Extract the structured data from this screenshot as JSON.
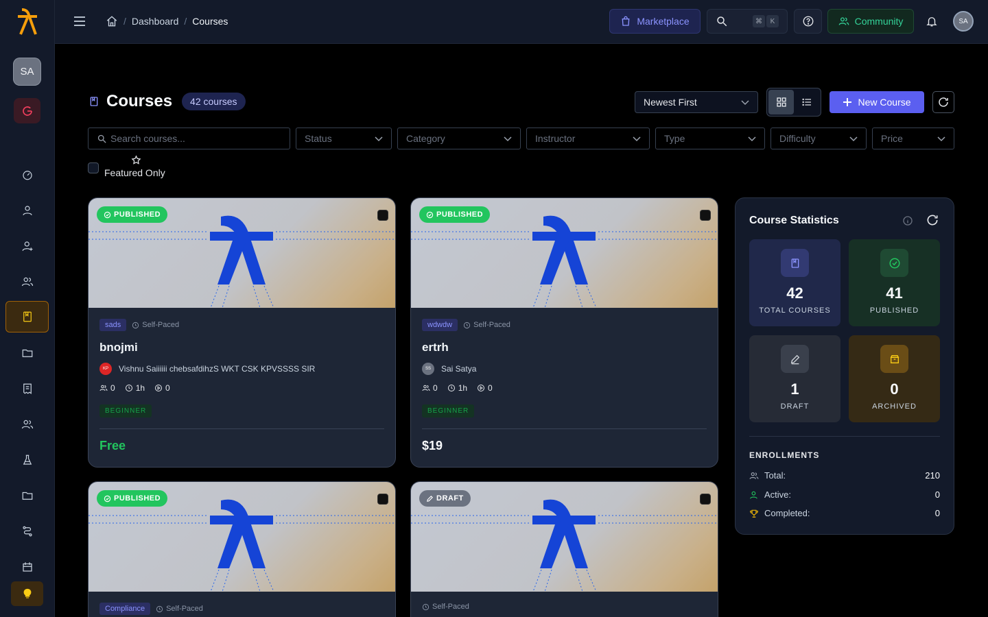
{
  "brand": {
    "accent": "#5b5ff0",
    "logo_color": "#f59e0b"
  },
  "sidebar": {
    "avatar_initials": "SA",
    "items": [
      {
        "icon": "gauge-icon"
      },
      {
        "icon": "user-icon"
      },
      {
        "icon": "user-plus-icon"
      },
      {
        "icon": "users-icon"
      },
      {
        "icon": "book-icon",
        "active": true
      },
      {
        "icon": "folder-icon"
      },
      {
        "icon": "receipt-icon"
      },
      {
        "icon": "users-icon"
      },
      {
        "icon": "flask-icon"
      },
      {
        "icon": "folder-icon"
      },
      {
        "icon": "route-icon"
      },
      {
        "icon": "calendar-icon"
      }
    ],
    "bottom_icon": "lightbulb-icon"
  },
  "topbar": {
    "breadcrumb": [
      "Dashboard",
      "Courses"
    ],
    "marketplace_label": "Marketplace",
    "search_shortcut": [
      "⌘",
      "K"
    ],
    "community_label": "Community",
    "avatar_initials": "SA"
  },
  "page": {
    "title": "Courses",
    "count_badge": "42 courses",
    "sort_value": "Newest First",
    "view_modes": [
      "grid",
      "list"
    ],
    "active_view": "grid",
    "new_course_label": "New Course"
  },
  "filters": {
    "search_placeholder": "Search courses...",
    "status": "Status",
    "category": "Category",
    "instructor": "Instructor",
    "type": "Type",
    "difficulty": "Difficulty",
    "price": "Price",
    "featured_label": "Featured Only"
  },
  "courses": [
    {
      "status": "PUBLISHED",
      "category": "sads",
      "pace": "Self-Paced",
      "title": "bnojmi",
      "instructor": "Vishnu Saiiiiii chebsafdihzS WKT CSK KPVSSSS SIR",
      "instructor_initials": "KP",
      "students": "0",
      "duration": "1h",
      "lessons": "0",
      "level": "BEGINNER",
      "price": "Free"
    },
    {
      "status": "PUBLISHED",
      "category": "wdwdw",
      "pace": "Self-Paced",
      "title": "ertrh",
      "instructor": "Sai Satya",
      "instructor_initials": "SS",
      "students": "0",
      "duration": "1h",
      "lessons": "0",
      "level": "BEGINNER",
      "price": "$19"
    },
    {
      "status": "PUBLISHED",
      "category": "Compliance",
      "pace": "Self-Paced"
    },
    {
      "status": "DRAFT",
      "pace": "Self-Paced"
    }
  ],
  "stats": {
    "title": "Course Statistics",
    "total": {
      "value": "42",
      "label": "TOTAL COURSES"
    },
    "published": {
      "value": "41",
      "label": "PUBLISHED"
    },
    "draft": {
      "value": "1",
      "label": "DRAFT"
    },
    "archived": {
      "value": "0",
      "label": "ARCHIVED"
    },
    "enrollments_title": "ENROLLMENTS",
    "enrollments": [
      {
        "label": "Total:",
        "value": "210",
        "icon": "users-icon"
      },
      {
        "label": "Active:",
        "value": "0",
        "icon": "user-check-icon"
      },
      {
        "label": "Completed:",
        "value": "0",
        "icon": "trophy-icon"
      }
    ]
  }
}
